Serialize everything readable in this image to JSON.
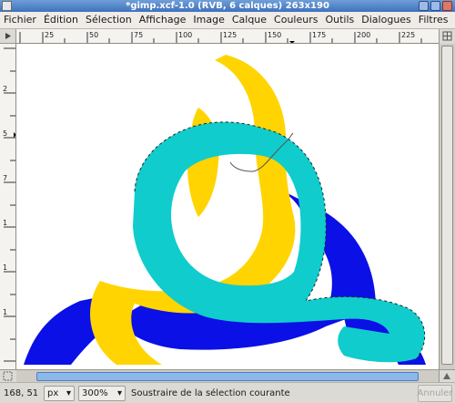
{
  "window": {
    "title": "*gimp.xcf-1.0 (RVB, 6 calques) 263x190"
  },
  "menubar": {
    "items": [
      "Fichier",
      "Édition",
      "Sélection",
      "Affichage",
      "Image",
      "Calque",
      "Couleurs",
      "Outils",
      "Dialogues",
      "Filtres"
    ]
  },
  "rulers": {
    "horizontal_labels": [
      "25",
      "50",
      "75",
      "100",
      "125",
      "150",
      "175",
      "200",
      "225"
    ],
    "vertical_labels": [
      "2",
      "5",
      "7",
      "1",
      "1",
      "1"
    ]
  },
  "canvas": {
    "colors": {
      "background": "#ffffff",
      "yellow": "#ffd400",
      "blue": "#0a10e6",
      "cyan": "#10cccc"
    }
  },
  "statusbar": {
    "coords": "168, 51",
    "unit": "px",
    "zoom": "300%",
    "message": "Soustraire de la sélection courante",
    "cancel_label": "Annuler"
  },
  "icons": [
    "window-menu-icon",
    "minimize-icon",
    "maximize-icon",
    "close-icon",
    "ruler-menu-icon",
    "navigate-icon",
    "quickmask-icon",
    "zoom-nav-icon",
    "dropdown-icon"
  ]
}
